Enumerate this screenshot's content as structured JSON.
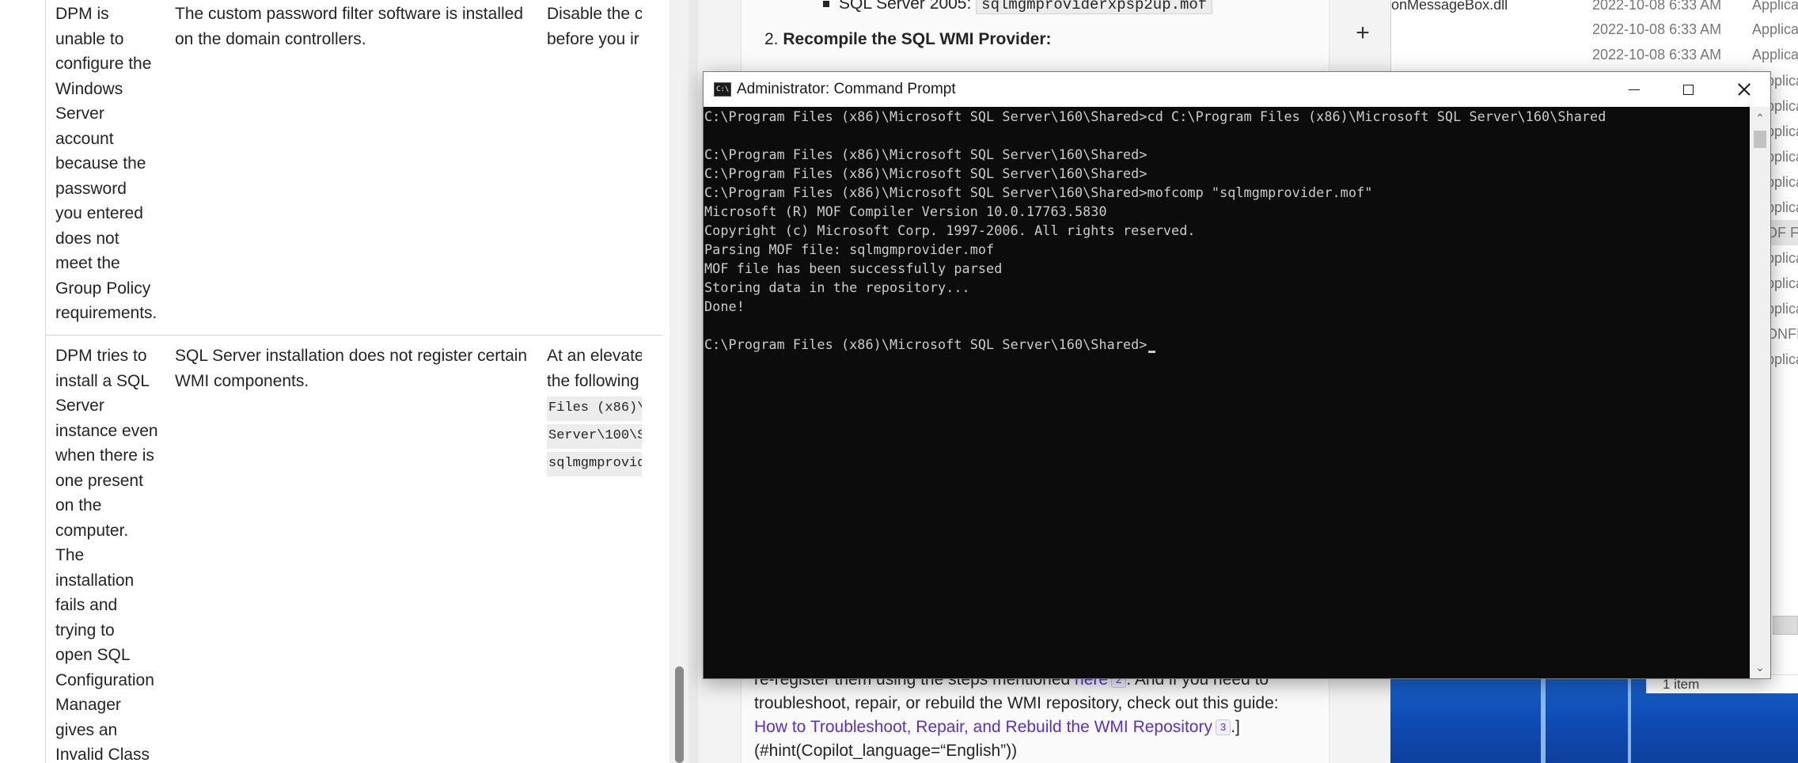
{
  "doc_table": {
    "rows": [
      {
        "problem": "DPM is unable to configure the Windows Server account because the password you entered does not meet the Group Policy requirements.",
        "problem_lines": [
          "DPM is",
          "unable to",
          "configure the",
          "Windows",
          "Server",
          "account",
          "because the",
          "password",
          "you entered",
          "does not",
          "meet the",
          "Group Policy",
          "requirements."
        ],
        "cause_lines": [
          "The custom password filter software is installed",
          "on the domain controllers."
        ],
        "resolution_lines": [
          "Disable the c",
          "before you ir"
        ]
      },
      {
        "problem_lines": [
          "DPM tries to",
          "install a SQL",
          "Server",
          "instance even",
          "when there is",
          "one present",
          "on the",
          "computer.",
          "The",
          "installation",
          "fails and",
          "trying to",
          "open SQL",
          "Configuration",
          "Manager",
          "gives an",
          "Invalid Class"
        ],
        "cause_lines": [
          "SQL Server installation does not register certain",
          "WMI components."
        ],
        "resolution_lines": [
          "At an elevate",
          "the following"
        ],
        "resolution_code_lines": [
          "Files (x86)\\",
          "Server\\100\\S",
          "sqlmgmprovid"
        ]
      }
    ]
  },
  "article": {
    "bullet_label": "SQL Server 2005:",
    "bullet_code": "sqlmgmproviderxpsp2up.mof",
    "step_number": "2.",
    "step_title": "Recompile the SQL WMI Provider:",
    "plus_symbol": "+",
    "bottom_text": {
      "line1_prefix": "re-register them using the steps mentioned ",
      "line1_link": "here",
      "line1_cite": "2",
      "line1_suffix": ". And if you need to",
      "line2": "troubleshoot, repair, or rebuild the WMI repository, check out this guide:",
      "line3_link": "How to Troubleshoot, Repair, and Rebuild the WMI Repository",
      "line3_cite": "3",
      "line3_suffix": ".]",
      "line4": "(#hint(Copilot_language=“English”))"
    }
  },
  "explorer": {
    "rows": [
      {
        "name": "onMessageBox.dll",
        "date": "2022-10-08 6:33 AM",
        "type": "Applica"
      },
      {
        "name": "",
        "date": "2022-10-08 6:33 AM",
        "type": "Applica"
      },
      {
        "name": "",
        "date": "2022-10-08 6:33 AM",
        "type": "Applica"
      }
    ],
    "type_slivers": [
      "pplica",
      "pplica",
      "pplica",
      "pplica",
      "pplica",
      "pplica",
      "OF Fi",
      "pplica",
      "pplica",
      "pplica",
      "ONFIG",
      "pplica"
    ],
    "status_text": "1 item"
  },
  "cmd_window": {
    "title": "Administrator: Command Prompt",
    "icon_glyph": "C:\\",
    "buttons": {
      "minimize": "minimize",
      "maximize": "maximize",
      "close": "close"
    },
    "lines": [
      "C:\\Program Files (x86)\\Microsoft SQL Server\\160\\Shared>cd C:\\Program Files (x86)\\Microsoft SQL Server\\160\\Shared",
      "",
      "C:\\Program Files (x86)\\Microsoft SQL Server\\160\\Shared>",
      "C:\\Program Files (x86)\\Microsoft SQL Server\\160\\Shared>",
      "C:\\Program Files (x86)\\Microsoft SQL Server\\160\\Shared>mofcomp \"sqlmgmprovider.mof\"",
      "Microsoft (R) MOF Compiler Version 10.0.17763.5830",
      "Copyright (c) Microsoft Corp. 1997-2006. All rights reserved.",
      "Parsing MOF file: sqlmgmprovider.mof",
      "MOF file has been successfully parsed",
      "Storing data in the repository...",
      "Done!",
      "",
      "C:\\Program Files (x86)\\Microsoft SQL Server\\160\\Shared>"
    ]
  }
}
